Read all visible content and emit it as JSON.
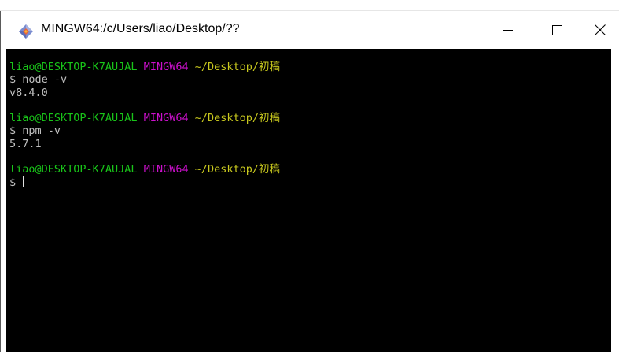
{
  "window": {
    "title": "MINGW64:/c/Users/liao/Desktop/??",
    "icon": "git-bash-diamond-icon",
    "controls": {
      "minimize": "minimize-icon",
      "maximize": "maximize-icon",
      "close": "close-icon"
    }
  },
  "colors": {
    "user_host": "#19c519",
    "system": "#cc10cc",
    "path": "#c8c81e",
    "output": "#c0c0c0",
    "background": "#000000"
  },
  "terminal": {
    "blocks": [
      {
        "user_host": "liao@DESKTOP-K7AUJAL",
        "system": "MINGW64",
        "path": "~/Desktop/初稿",
        "prompt": "$ ",
        "command": "node -v",
        "output": "v8.4.0"
      },
      {
        "user_host": "liao@DESKTOP-K7AUJAL",
        "system": "MINGW64",
        "path": "~/Desktop/初稿",
        "prompt": "$ ",
        "command": "npm -v",
        "output": "5.7.1"
      },
      {
        "user_host": "liao@DESKTOP-K7AUJAL",
        "system": "MINGW64",
        "path": "~/Desktop/初稿",
        "prompt": "$ ",
        "command": ""
      }
    ]
  }
}
